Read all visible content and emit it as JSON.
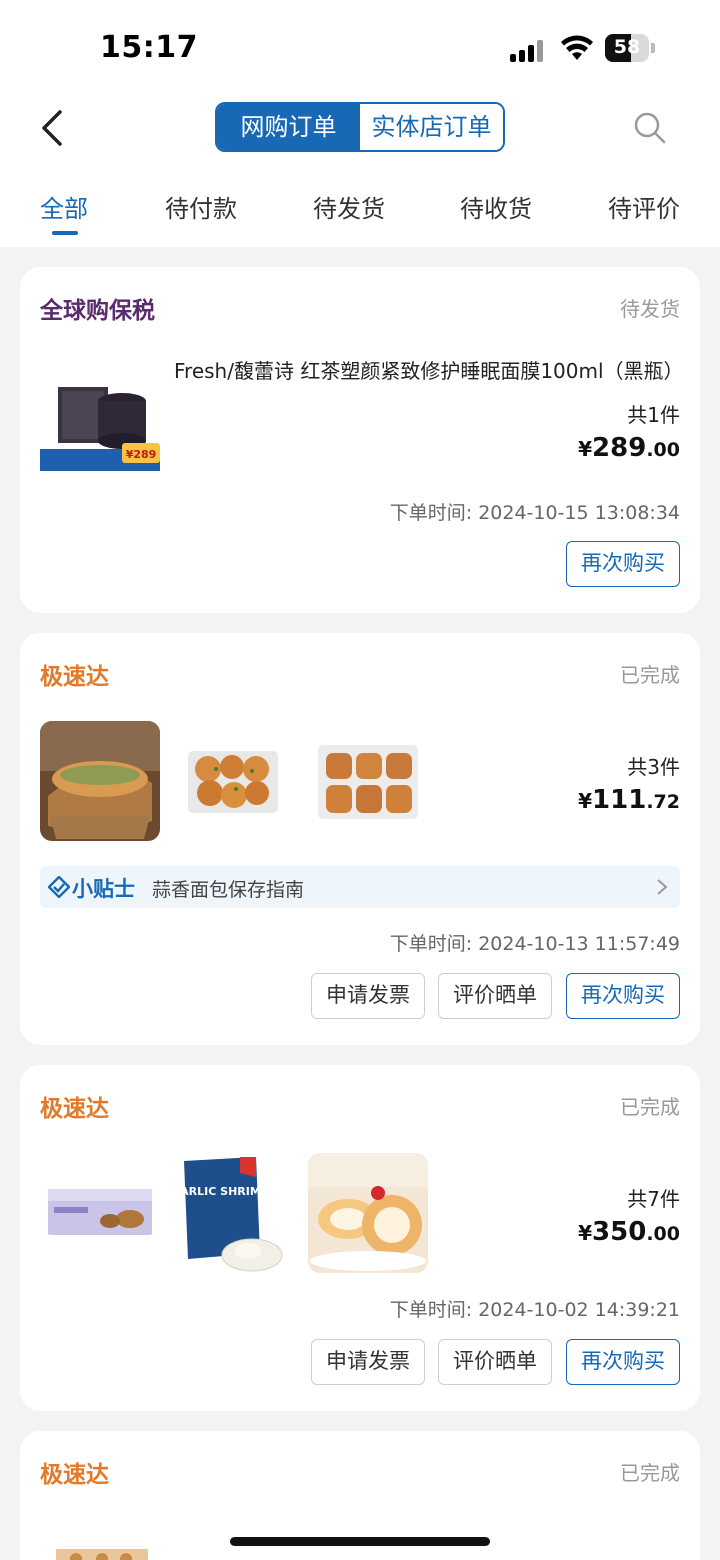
{
  "status_bar": {
    "time": "15:17",
    "battery": "58",
    "battery_level": 0.58
  },
  "segment": {
    "online": "网购订单",
    "store": "实体店订单"
  },
  "tabs": [
    "全部",
    "待付款",
    "待发货",
    "待收货",
    "待评价"
  ],
  "orders": [
    {
      "store": "全球购保税",
      "status": "待发货",
      "title": "Fresh/馥蕾诗 红茶塑颜紧致修护睡眠面膜100ml（黑瓶）",
      "count": "共1件",
      "price_yen": "¥",
      "price_int": "289",
      "price_dec": ".00",
      "time": "下单时间: 2024-10-15 13:08:34",
      "thumb_badge": "¥289",
      "buttons": {
        "rebuy": "再次购买"
      }
    },
    {
      "store": "极速达",
      "status": "已完成",
      "count": "共3件",
      "price_yen": "¥",
      "price_int": "111",
      "price_dec": ".72",
      "tip_label": "小贴士",
      "tip_text": "蒜香面包保存指南",
      "time": "下单时间: 2024-10-13 11:57:49",
      "buttons": {
        "invoice": "申请发票",
        "review": "评价晒单",
        "rebuy": "再次购买"
      }
    },
    {
      "store": "极速达",
      "status": "已完成",
      "count": "共7件",
      "price_yen": "¥",
      "price_int": "350",
      "price_dec": ".00",
      "time": "下单时间: 2024-10-02 14:39:21",
      "thumb_text": "GARLIC SHRIMP",
      "buttons": {
        "invoice": "申请发票",
        "review": "评价晒单",
        "rebuy": "再次购买"
      }
    },
    {
      "store": "极速达",
      "status": "已完成"
    }
  ],
  "colors": {
    "brand": "#1869b5",
    "global": "#5a2a6e",
    "speedy": "#e37a2a"
  }
}
